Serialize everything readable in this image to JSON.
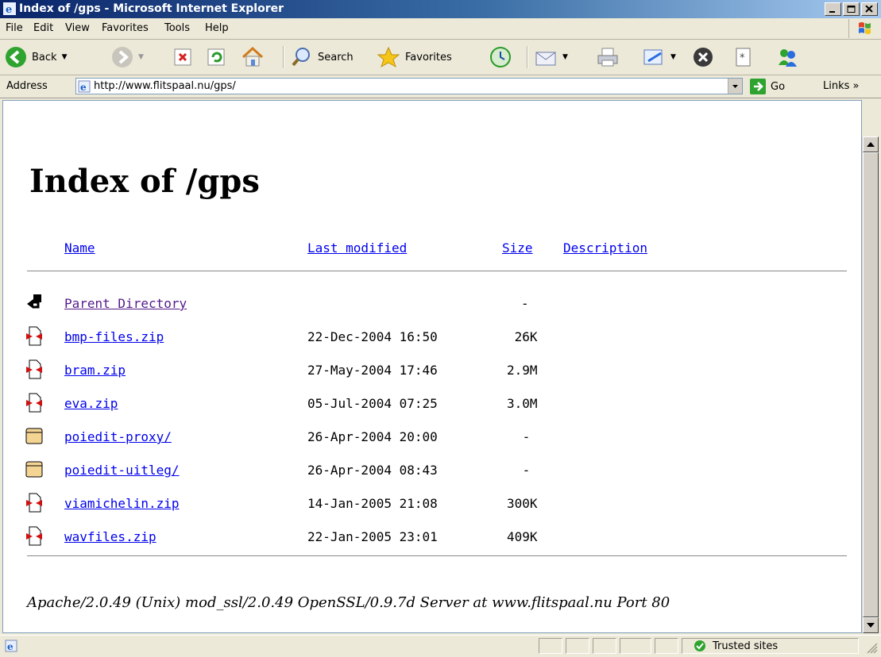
{
  "window": {
    "title": "Index of /gps - Microsoft Internet Explorer"
  },
  "menu": [
    {
      "label": "File"
    },
    {
      "label": "Edit"
    },
    {
      "label": "View"
    },
    {
      "label": "Favorites"
    },
    {
      "label": "Tools"
    },
    {
      "label": "Help"
    }
  ],
  "toolbar": {
    "back_label": "Back",
    "search_label": "Search",
    "favorites_label": "Favorites"
  },
  "address": {
    "label": "Address",
    "url": "http://www.flitspaal.nu/gps/",
    "go_label": "Go",
    "links_label": "Links »"
  },
  "page": {
    "heading": "Index of /gps",
    "columns": {
      "name": "Name",
      "last_modified": "Last modified",
      "size": "Size",
      "description": "Description"
    },
    "rows": [
      {
        "icon": "parent-directory-icon",
        "name": "Parent Directory",
        "date": "",
        "size": "-"
      },
      {
        "icon": "zip-file-icon",
        "name": "bmp-files.zip",
        "date": "22-Dec-2004 16:50",
        "size": " 26K"
      },
      {
        "icon": "zip-file-icon",
        "name": "bram.zip",
        "date": "27-May-2004 17:46",
        "size": "2.9M"
      },
      {
        "icon": "zip-file-icon",
        "name": "eva.zip",
        "date": "05-Jul-2004 07:25",
        "size": "3.0M"
      },
      {
        "icon": "folder-icon",
        "name": "poiedit-proxy/",
        "date": "26-Apr-2004 20:00",
        "size": " -"
      },
      {
        "icon": "folder-icon",
        "name": "poiedit-uitleg/",
        "date": "26-Apr-2004 08:43",
        "size": " -"
      },
      {
        "icon": "zip-file-icon",
        "name": "viamichelin.zip",
        "date": "14-Jan-2005 21:08",
        "size": "300K"
      },
      {
        "icon": "zip-file-icon",
        "name": "wavfiles.zip",
        "date": "22-Jan-2005 23:01",
        "size": "409K"
      }
    ],
    "server_signature": "Apache/2.0.49 (Unix) mod_ssl/2.0.49 OpenSSL/0.9.7d Server at www.flitspaal.nu Port 80"
  },
  "status": {
    "zone_label": "Trusted sites"
  }
}
